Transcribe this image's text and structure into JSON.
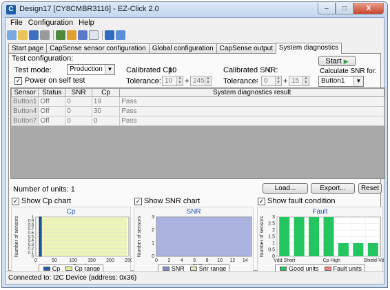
{
  "window": {
    "title": "Design17 [CY8CMBR3116] - EZ-Click 2.0",
    "minimize_glyph": "–",
    "maximize_glyph": "□",
    "close_glyph": "X"
  },
  "menu": [
    {
      "label": "File",
      "accel": "F"
    },
    {
      "label": "Configuration",
      "accel": "C"
    },
    {
      "label": "Help",
      "accel": "H"
    }
  ],
  "toolbar_icons": [
    "new-icon",
    "open-icon",
    "save-icon",
    "print-icon",
    "export-icon",
    "import-icon",
    "report-icon",
    "document-icon",
    "connect-icon",
    "disconnect-icon"
  ],
  "tabs": [
    {
      "label": "Start page",
      "active": false
    },
    {
      "label": "CapSense sensor configuration",
      "active": false
    },
    {
      "label": "Global configuration",
      "active": false
    },
    {
      "label": "CapSense output",
      "active": false
    },
    {
      "label": "System diagnostics",
      "active": true
    }
  ],
  "test_config": {
    "group_label": "Test configuration:",
    "test_mode_label": "Test mode:",
    "test_mode_value": "Production",
    "power_on_label": "Power on self test",
    "power_on_checked": true,
    "cal_cp_label": "Calibrated Cp:",
    "cal_cp_value": "10",
    "tolerance_label": "Tolerance:",
    "cp_tol_minus": "-",
    "cp_tol_low": "10",
    "cp_tol_plus": "+",
    "cp_tol_high": "245",
    "cal_snr_label": "Calibrated SNR:",
    "cal_snr_value": "0",
    "snr_tol_label": "Tolerance:",
    "snr_tol_minus": "-",
    "snr_tol_low": "0",
    "snr_tol_plus": "+",
    "snr_tol_high": "15",
    "start_label": "Start",
    "calc_snr_label": "Calculate SNR for:",
    "calc_snr_value": "Button1"
  },
  "grid": {
    "headers": [
      "Sensor",
      "Status",
      "SNR",
      "Cp",
      "System diagnostics result"
    ],
    "rows": [
      [
        "Button1",
        "Off",
        "0",
        "19",
        "Pass"
      ],
      [
        "Button4",
        "Off",
        "0",
        "30",
        "Pass"
      ],
      [
        "Button7",
        "Off",
        "0",
        "0",
        "Pass"
      ]
    ]
  },
  "units_label": "Number of units: 1",
  "buttons": {
    "load": "Load...",
    "export": "Export...",
    "reset": "Reset"
  },
  "chart_toggles": {
    "cp": {
      "label": "Show Cp chart",
      "checked": true
    },
    "snr": {
      "label": "Show SNR chart",
      "checked": true
    },
    "fault": {
      "label": "Show fault condition",
      "checked": true
    }
  },
  "chart_data": [
    {
      "type": "bar",
      "title": "Cp",
      "xlabel": "Cp value",
      "ylabel": "Number of sensors",
      "x_ticks": [
        "0",
        "50",
        "100",
        "150",
        "200",
        "250"
      ],
      "y_ticks": [
        "0",
        "0.1",
        "0.2",
        "0.3",
        "0.4",
        "0.5",
        "0.6",
        "0.7",
        "0.8",
        "0.9",
        "1"
      ],
      "xlim": [
        0,
        250
      ],
      "ylim": [
        0,
        1
      ],
      "bars": [
        {
          "x": 12,
          "value": 1
        }
      ],
      "range": [
        10,
        245
      ],
      "legend": [
        {
          "name": "Cp",
          "color": "#1f5fa8"
        },
        {
          "name": "Cp range",
          "color": "#e6ef9a"
        }
      ]
    },
    {
      "type": "bar",
      "title": "SNR",
      "xlabel": "SNR value",
      "ylabel": "Number of sensors",
      "x_ticks": [
        "0",
        "2",
        "4",
        "6",
        "8",
        "10",
        "12",
        "14"
      ],
      "y_ticks": [
        "0",
        "1",
        "2",
        "3"
      ],
      "xlim": [
        0,
        15
      ],
      "ylim": [
        0,
        3
      ],
      "bars": [],
      "range": [
        0,
        15
      ],
      "legend": [
        {
          "name": "SNR",
          "color": "#8090c8"
        },
        {
          "name": "Snr range",
          "color": "#d8ecb8"
        }
      ]
    },
    {
      "type": "bar",
      "title": "Fault",
      "xlabel": "",
      "ylabel": "Number of sensors",
      "y_ticks": [
        "0",
        "0.5",
        "1",
        "1.5",
        "2",
        "2.5",
        "3"
      ],
      "ylim": [
        0,
        3
      ],
      "categories": [
        "Vdd Short",
        "",
        "Cp High",
        "",
        "Shield-Vdd Sh"
      ],
      "series": [
        {
          "name": "Good units",
          "values": [
            3,
            3,
            3,
            3,
            1,
            1,
            1
          ],
          "color": "#22c55e"
        },
        {
          "name": "Fault units",
          "values": [
            0,
            0,
            0,
            0,
            0,
            0,
            0
          ],
          "color": "#f08080"
        }
      ]
    }
  ],
  "status": "Connected to: I2C Device (address: 0x36)"
}
